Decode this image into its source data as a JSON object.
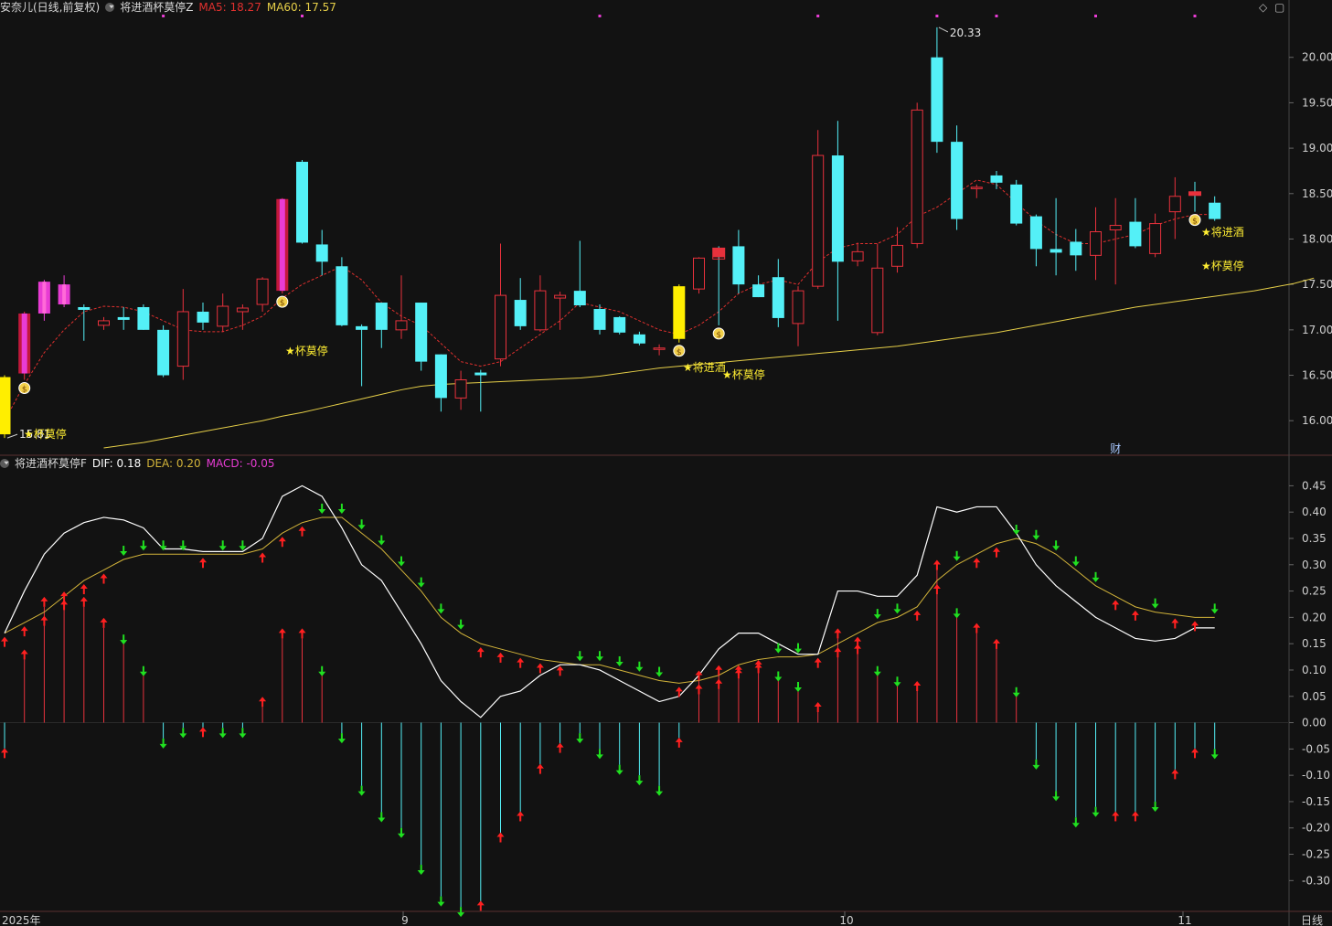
{
  "header_main": {
    "stock": "安奈儿(日线,前复权)",
    "indicator": "将进酒杯莫停Z",
    "ma5": "MA5: 18.27",
    "ma60": "MA60: 17.57"
  },
  "header_sub": {
    "indicator": "将进酒杯莫停F",
    "dif": "DIF: 0.18",
    "dea": "DEA: 0.20",
    "macd": "MACD: -0.05"
  },
  "window_controls": {
    "restore": "◇",
    "maximize": "▢"
  },
  "colors": {
    "background": "#121212",
    "up": "#e8313c",
    "down": "#54f0f7",
    "special_bar": "#ffee00",
    "magenta_bar": "#e83cd4",
    "ma5": "#e0302e",
    "ma60": "#e6cf48",
    "dif": "#ffffff",
    "dea": "#d3b43a",
    "arrow_up": "#ff2020",
    "arrow_down": "#20e020",
    "label": "#ffee33"
  },
  "x_axis": {
    "labels": [
      "2025年",
      "9",
      "10",
      "11"
    ],
    "period": "日线"
  },
  "chart_data": [
    {
      "type": "candlestick",
      "title": "安奈儿(日线,前复权)",
      "ylim": [
        15.65,
        20.45
      ],
      "yticks": [
        "20.00",
        "19.50",
        "19.00",
        "18.50",
        "18.00",
        "17.50",
        "17.00",
        "16.50",
        "16.00"
      ],
      "candles": [
        {
          "o": 16.48,
          "h": 16.5,
          "l": 15.81,
          "c": 15.85,
          "kind": "yellow"
        },
        {
          "o": 16.52,
          "h": 17.2,
          "l": 16.45,
          "c": 17.18,
          "kind": "up_fill"
        },
        {
          "o": 17.18,
          "h": 17.55,
          "l": 17.1,
          "c": 17.53,
          "kind": "magenta"
        },
        {
          "o": 17.28,
          "h": 17.6,
          "l": 17.25,
          "c": 17.5,
          "kind": "magenta"
        },
        {
          "o": 17.25,
          "h": 17.28,
          "l": 16.88,
          "c": 17.22,
          "kind": "down"
        },
        {
          "o": 17.05,
          "h": 17.14,
          "l": 17.0,
          "c": 17.1,
          "kind": "up"
        },
        {
          "o": 17.14,
          "h": 17.25,
          "l": 17.0,
          "c": 17.11,
          "kind": "down"
        },
        {
          "o": 17.25,
          "h": 17.28,
          "l": 17.0,
          "c": 17.0,
          "kind": "down"
        },
        {
          "o": 17.0,
          "h": 17.05,
          "l": 16.48,
          "c": 16.5,
          "kind": "down"
        },
        {
          "o": 16.6,
          "h": 17.45,
          "l": 16.45,
          "c": 17.2,
          "kind": "up"
        },
        {
          "o": 17.2,
          "h": 17.3,
          "l": 17.0,
          "c": 17.08,
          "kind": "down"
        },
        {
          "o": 17.04,
          "h": 17.4,
          "l": 16.98,
          "c": 17.26,
          "kind": "up"
        },
        {
          "o": 17.2,
          "h": 17.28,
          "l": 17.0,
          "c": 17.24,
          "kind": "up"
        },
        {
          "o": 17.28,
          "h": 17.58,
          "l": 17.2,
          "c": 17.56,
          "kind": "up"
        },
        {
          "o": 17.43,
          "h": 18.45,
          "l": 17.4,
          "c": 18.44,
          "kind": "up_fill"
        },
        {
          "o": 18.85,
          "h": 18.87,
          "l": 17.95,
          "c": 17.96,
          "kind": "down"
        },
        {
          "o": 17.94,
          "h": 18.1,
          "l": 17.6,
          "c": 17.75,
          "kind": "down"
        },
        {
          "o": 17.7,
          "h": 17.8,
          "l": 17.04,
          "c": 17.05,
          "kind": "down"
        },
        {
          "o": 17.04,
          "h": 17.06,
          "l": 16.38,
          "c": 17.0,
          "kind": "down"
        },
        {
          "o": 17.3,
          "h": 17.3,
          "l": 16.8,
          "c": 17.0,
          "kind": "down"
        },
        {
          "o": 17.0,
          "h": 17.6,
          "l": 16.9,
          "c": 17.1,
          "kind": "up"
        },
        {
          "o": 17.3,
          "h": 17.3,
          "l": 16.55,
          "c": 16.65,
          "kind": "down"
        },
        {
          "o": 16.73,
          "h": 16.73,
          "l": 16.1,
          "c": 16.25,
          "kind": "down"
        },
        {
          "o": 16.25,
          "h": 16.55,
          "l": 16.12,
          "c": 16.45,
          "kind": "up"
        },
        {
          "o": 16.53,
          "h": 16.56,
          "l": 16.1,
          "c": 16.5,
          "kind": "down"
        },
        {
          "o": 16.68,
          "h": 17.95,
          "l": 16.6,
          "c": 17.38,
          "kind": "up"
        },
        {
          "o": 17.33,
          "h": 17.57,
          "l": 17.0,
          "c": 17.04,
          "kind": "down"
        },
        {
          "o": 17.0,
          "h": 17.6,
          "l": 16.98,
          "c": 17.43,
          "kind": "up"
        },
        {
          "o": 17.35,
          "h": 17.42,
          "l": 17.0,
          "c": 17.38,
          "kind": "up"
        },
        {
          "o": 17.43,
          "h": 17.98,
          "l": 17.25,
          "c": 17.27,
          "kind": "down"
        },
        {
          "o": 17.23,
          "h": 17.28,
          "l": 16.95,
          "c": 17.0,
          "kind": "down"
        },
        {
          "o": 17.14,
          "h": 17.15,
          "l": 16.95,
          "c": 16.97,
          "kind": "down"
        },
        {
          "o": 16.95,
          "h": 16.98,
          "l": 16.83,
          "c": 16.85,
          "kind": "down"
        },
        {
          "o": 16.8,
          "h": 16.84,
          "l": 16.72,
          "c": 16.8,
          "kind": "down"
        },
        {
          "o": 16.9,
          "h": 17.5,
          "l": 16.86,
          "c": 17.48,
          "kind": "yellow"
        },
        {
          "o": 17.45,
          "h": 17.8,
          "l": 17.4,
          "c": 17.79,
          "kind": "up"
        },
        {
          "o": 17.9,
          "h": 17.92,
          "l": 17.05,
          "c": 17.78,
          "kind": "red_fill_top"
        },
        {
          "o": 17.92,
          "h": 18.1,
          "l": 17.4,
          "c": 17.5,
          "kind": "down"
        },
        {
          "o": 17.5,
          "h": 17.6,
          "l": 17.36,
          "c": 17.36,
          "kind": "down"
        },
        {
          "o": 17.58,
          "h": 17.78,
          "l": 17.03,
          "c": 17.13,
          "kind": "down"
        },
        {
          "o": 17.07,
          "h": 17.48,
          "l": 16.82,
          "c": 17.43,
          "kind": "up"
        },
        {
          "o": 17.48,
          "h": 19.2,
          "l": 17.45,
          "c": 18.92,
          "kind": "up"
        },
        {
          "o": 18.92,
          "h": 19.3,
          "l": 17.1,
          "c": 17.75,
          "kind": "down"
        },
        {
          "o": 17.76,
          "h": 17.96,
          "l": 17.7,
          "c": 17.86,
          "kind": "up"
        },
        {
          "o": 16.97,
          "h": 17.95,
          "l": 16.94,
          "c": 17.68,
          "kind": "up"
        },
        {
          "o": 17.7,
          "h": 18.13,
          "l": 17.63,
          "c": 17.93,
          "kind": "up"
        },
        {
          "o": 17.95,
          "h": 19.5,
          "l": 17.9,
          "c": 19.42,
          "kind": "up"
        },
        {
          "o": 20.0,
          "h": 20.33,
          "l": 18.95,
          "c": 19.07,
          "kind": "down"
        },
        {
          "o": 19.07,
          "h": 19.25,
          "l": 18.1,
          "c": 18.22,
          "kind": "down"
        },
        {
          "o": 18.57,
          "h": 18.6,
          "l": 18.45,
          "c": 18.57,
          "kind": "up"
        },
        {
          "o": 18.7,
          "h": 18.75,
          "l": 18.55,
          "c": 18.62,
          "kind": "down"
        },
        {
          "o": 18.6,
          "h": 18.65,
          "l": 18.15,
          "c": 18.17,
          "kind": "down"
        },
        {
          "o": 18.25,
          "h": 18.27,
          "l": 17.7,
          "c": 17.89,
          "kind": "down"
        },
        {
          "o": 17.89,
          "h": 18.45,
          "l": 17.6,
          "c": 17.85,
          "kind": "down"
        },
        {
          "o": 17.97,
          "h": 18.11,
          "l": 17.65,
          "c": 17.82,
          "kind": "down"
        },
        {
          "o": 17.82,
          "h": 18.35,
          "l": 17.55,
          "c": 18.08,
          "kind": "up"
        },
        {
          "o": 18.1,
          "h": 18.45,
          "l": 17.5,
          "c": 18.15,
          "kind": "up"
        },
        {
          "o": 18.19,
          "h": 18.45,
          "l": 17.9,
          "c": 17.92,
          "kind": "down"
        },
        {
          "o": 17.84,
          "h": 18.28,
          "l": 17.8,
          "c": 18.17,
          "kind": "up"
        },
        {
          "o": 18.3,
          "h": 18.68,
          "l": 18.0,
          "c": 18.47,
          "kind": "up"
        },
        {
          "o": 18.52,
          "h": 18.63,
          "l": 18.3,
          "c": 18.48,
          "kind": "red_fill_top"
        },
        {
          "o": 18.4,
          "h": 18.47,
          "l": 18.2,
          "c": 18.22,
          "kind": "down"
        }
      ],
      "ma5": [
        16.0,
        16.4,
        16.75,
        17.0,
        17.2,
        17.26,
        17.25,
        17.2,
        17.1,
        17.0,
        16.98,
        16.98,
        17.05,
        17.15,
        17.35,
        17.5,
        17.6,
        17.7,
        17.55,
        17.3,
        17.15,
        17.05,
        16.85,
        16.65,
        16.6,
        16.65,
        16.8,
        16.95,
        17.1,
        17.3,
        17.25,
        17.2,
        17.1,
        17.0,
        16.95,
        17.05,
        17.2,
        17.4,
        17.5,
        17.55,
        17.5,
        17.75,
        17.9,
        17.95,
        17.95,
        18.05,
        18.25,
        18.35,
        18.5,
        18.65,
        18.6,
        18.4,
        18.2,
        18.05,
        17.95,
        17.95,
        18.0,
        18.05,
        18.15,
        18.22,
        18.27,
        18.27
      ],
      "ma60": [
        15.7,
        15.73,
        15.76,
        15.8,
        15.84,
        15.88,
        15.92,
        15.96,
        16.0,
        16.05,
        16.09,
        16.14,
        16.19,
        16.24,
        16.29,
        16.34,
        16.38,
        16.4,
        16.41,
        16.42,
        16.43,
        16.44,
        16.45,
        16.46,
        16.47,
        16.49,
        16.52,
        16.55,
        16.58,
        16.6,
        16.62,
        16.64,
        16.66,
        16.68,
        16.7,
        16.72,
        16.74,
        16.76,
        16.78,
        16.8,
        16.82,
        16.85,
        16.88,
        16.91,
        16.94,
        16.97,
        17.01,
        17.05,
        17.09,
        17.13,
        17.17,
        17.21,
        17.25,
        17.28,
        17.31,
        17.34,
        17.37,
        17.4,
        17.43,
        17.47,
        17.51,
        17.57
      ],
      "markers": [
        {
          "index": 0,
          "text": "15.81",
          "kind": "low_label"
        },
        {
          "index": 47,
          "text": "20.33",
          "kind": "high_label"
        },
        {
          "index": 0,
          "text": "★杯莫停",
          "kind": "signal"
        },
        {
          "index": 15,
          "text": "★杯莫停",
          "kind": "signal"
        },
        {
          "index": 34,
          "text": "★将进酒",
          "kind": "signal"
        },
        {
          "index": 36,
          "text": "★杯莫停",
          "kind": "signal"
        },
        {
          "index": 61,
          "text": "★将进酒",
          "kind": "signal"
        },
        {
          "index": 61,
          "text": "★杯莫停",
          "kind": "signal"
        },
        {
          "index": 56,
          "text": "财",
          "kind": "finance"
        }
      ],
      "money_icons": [
        1,
        14,
        34,
        36,
        60
      ],
      "top_dots": [
        8,
        15,
        30,
        41,
        47,
        50,
        55,
        60
      ]
    },
    {
      "type": "macd",
      "title": "将进酒杯莫停F",
      "ylim": [
        -0.355,
        0.475
      ],
      "yticks": [
        "0.45",
        "0.40",
        "0.35",
        "0.30",
        "0.25",
        "0.20",
        "0.15",
        "0.10",
        "0.05",
        "0.00",
        "-0.05",
        "-0.10",
        "-0.15",
        "-0.20",
        "-0.25",
        "-0.30"
      ],
      "dif": [
        0.17,
        0.25,
        0.32,
        0.36,
        0.38,
        0.39,
        0.385,
        0.37,
        0.33,
        0.33,
        0.325,
        0.325,
        0.325,
        0.35,
        0.43,
        0.45,
        0.43,
        0.37,
        0.3,
        0.27,
        0.21,
        0.15,
        0.08,
        0.04,
        0.01,
        0.05,
        0.06,
        0.09,
        0.11,
        0.11,
        0.1,
        0.08,
        0.06,
        0.04,
        0.05,
        0.09,
        0.14,
        0.17,
        0.17,
        0.15,
        0.13,
        0.13,
        0.25,
        0.25,
        0.24,
        0.24,
        0.28,
        0.41,
        0.4,
        0.41,
        0.41,
        0.36,
        0.3,
        0.26,
        0.23,
        0.2,
        0.18,
        0.16,
        0.155,
        0.16,
        0.18,
        0.18
      ],
      "dea": [
        0.17,
        0.19,
        0.21,
        0.24,
        0.27,
        0.29,
        0.31,
        0.32,
        0.32,
        0.32,
        0.32,
        0.32,
        0.32,
        0.33,
        0.36,
        0.38,
        0.39,
        0.39,
        0.36,
        0.33,
        0.29,
        0.25,
        0.2,
        0.17,
        0.15,
        0.14,
        0.13,
        0.12,
        0.115,
        0.11,
        0.11,
        0.1,
        0.09,
        0.08,
        0.075,
        0.08,
        0.09,
        0.11,
        0.12,
        0.125,
        0.125,
        0.13,
        0.15,
        0.17,
        0.19,
        0.2,
        0.22,
        0.27,
        0.3,
        0.32,
        0.34,
        0.35,
        0.34,
        0.32,
        0.29,
        0.26,
        0.24,
        0.22,
        0.21,
        0.205,
        0.2,
        0.2
      ],
      "macd": [
        -0.05,
        0.12,
        0.22,
        0.23,
        0.22,
        0.18,
        0.15,
        0.09,
        -0.03,
        -0.01,
        -0.01,
        -0.01,
        -0.01,
        0.03,
        0.16,
        0.16,
        0.09,
        -0.02,
        -0.12,
        -0.17,
        -0.2,
        -0.27,
        -0.33,
        -0.35,
        -0.34,
        -0.21,
        -0.17,
        -0.08,
        -0.04,
        -0.02,
        -0.05,
        -0.08,
        -0.1,
        -0.12,
        -0.03,
        0.08,
        0.09,
        0.09,
        0.1,
        0.08,
        0.06,
        0.02,
        0.16,
        0.13,
        0.09,
        0.07,
        0.06,
        0.29,
        0.2,
        0.17,
        0.14,
        0.05,
        -0.07,
        -0.13,
        -0.18,
        -0.16,
        -0.17,
        -0.17,
        -0.15,
        -0.09,
        -0.05,
        -0.05
      ],
      "arrows": "u,u,u,u,u,u,d,d,d,d,u,d,d,u,u,u,d,d,d,d,d,d,d,d,u,u,u,u,u,d,d,d,d,d,u,u,u,u,u,d,d,u,u,u,d,d,u,u,d,u,u,d,d,d,d,d,u,u,d,u,u,d"
    }
  ]
}
